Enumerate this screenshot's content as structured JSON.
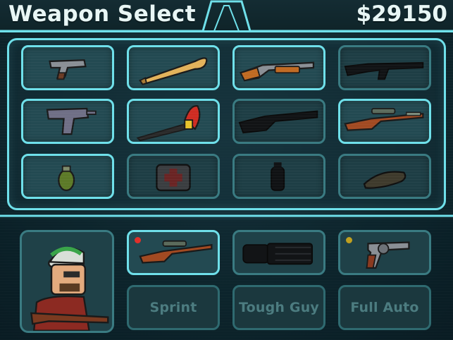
{
  "header": {
    "title": "Weapon Select",
    "cash": "$29150"
  },
  "colors": {
    "accent": "#6fe0ea",
    "panel": "#234a52",
    "background": "#0f2930",
    "text": "#e8f6f5"
  },
  "weapon_grid": [
    {
      "icon": "pistol-icon",
      "locked": false
    },
    {
      "icon": "baseball-bat-icon",
      "locked": false
    },
    {
      "icon": "shotgun-icon",
      "locked": false
    },
    {
      "icon": "assault-rifle-icon",
      "locked": true
    },
    {
      "icon": "uzi-icon",
      "locked": false
    },
    {
      "icon": "fire-axe-icon",
      "locked": false
    },
    {
      "icon": "heavy-shotgun-icon",
      "locked": true
    },
    {
      "icon": "sniper-rifle-icon",
      "locked": false
    },
    {
      "icon": "grenade-icon",
      "locked": false
    },
    {
      "icon": "medkit-icon",
      "locked": true
    },
    {
      "icon": "canister-icon",
      "locked": true
    },
    {
      "icon": "landmine-icon",
      "locked": true
    }
  ],
  "equipped": [
    {
      "icon": "sniper-rifle-icon",
      "indicator": "#e0302a",
      "selected": true
    },
    {
      "icon": "minigun-icon",
      "indicator": "",
      "selected": false
    },
    {
      "icon": "revolver-icon",
      "indicator": "#c0a020",
      "selected": false
    }
  ],
  "skills": [
    {
      "label": "Sprint"
    },
    {
      "label": "Tough Guy"
    },
    {
      "label": "Full Auto"
    }
  ]
}
